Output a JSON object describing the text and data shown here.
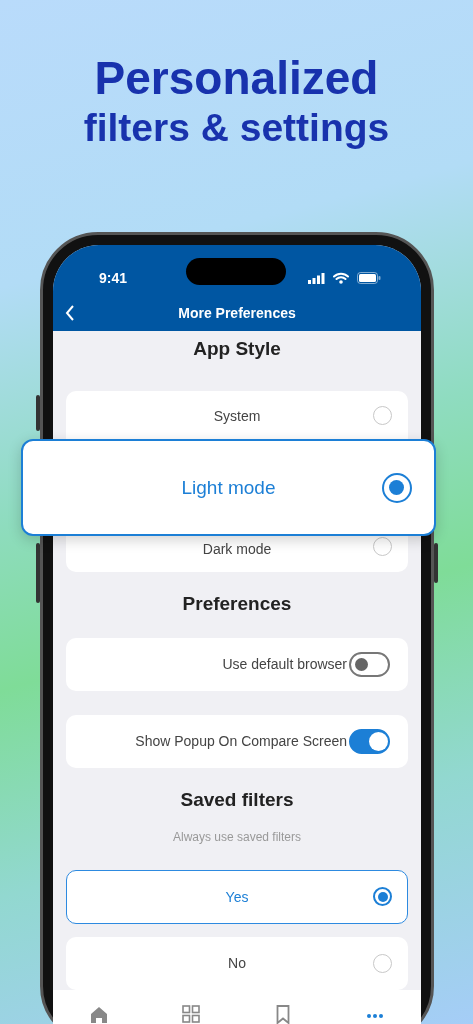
{
  "headline": {
    "title": "Personalized",
    "subtitle": "filters & settings"
  },
  "status_bar": {
    "time": "9:41"
  },
  "nav_bar": {
    "title": "More Preferences"
  },
  "sections": [
    {
      "title": "App Style",
      "kind": "radio",
      "options": [
        {
          "label": "System",
          "selected": false,
          "popped_out": false
        },
        {
          "label": "Light mode",
          "selected": true,
          "popped_out": true
        },
        {
          "label": "Dark mode",
          "selected": false,
          "popped_out": false
        }
      ]
    },
    {
      "title": "Preferences",
      "kind": "toggles",
      "options": [
        {
          "label": "Use default browser",
          "on": false
        },
        {
          "label": "Show Popup On Compare Screen",
          "on": true
        }
      ]
    },
    {
      "title": "Saved filters",
      "subtitle": "Always use saved filters",
      "kind": "radio",
      "options": [
        {
          "label": "Yes",
          "selected": true,
          "popped_out": false
        },
        {
          "label": "No",
          "selected": false,
          "popped_out": false
        }
      ]
    }
  ],
  "tab_bar": [
    {
      "kind": "home",
      "selected": false
    },
    {
      "kind": "grid",
      "selected": false
    },
    {
      "kind": "bookmark",
      "selected": false
    },
    {
      "kind": "more",
      "selected": true
    }
  ]
}
